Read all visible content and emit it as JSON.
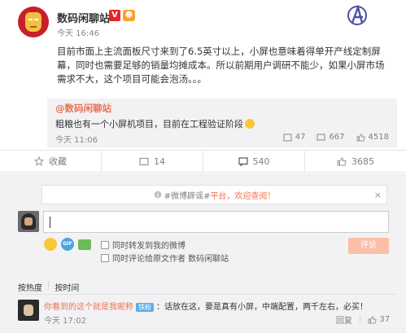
{
  "post": {
    "author": "数码闲聊站",
    "v_badge": "V",
    "vip_badge": "☻",
    "timestamp": "今天 16:46",
    "text": "目前市面上主流面板尺寸来到了6.5英寸以上，小屏也意味着得单开产线定制屏幕，同时也需要足够的销量均摊成本。所以前期用户调研不能少，如果小屏市场需求不大，这个项目可能会泡汤。。。"
  },
  "repost": {
    "author": "@数码闲聊站",
    "text": "粗粮也有一个小屏机项目，目前在工程验证阶段",
    "time": "今天 11:06",
    "forward_count": "47",
    "comment_count": "667",
    "like_count": "4518"
  },
  "actions": {
    "favorite": "收藏",
    "forward": "14",
    "comment": "540",
    "like": "3685"
  },
  "notice": {
    "prefix": "#微博辟谣#",
    "highlight": "平台，欢迎查阅！",
    "close": "×"
  },
  "compose": {
    "option_forward": "同时转发到我的微博",
    "option_comment_original": "同时评论给原文作者 数码闲聊站",
    "submit": "评论",
    "gif": "GIF"
  },
  "sort": {
    "by_hot": "按热度",
    "sep": "|",
    "by_time": "按时间"
  },
  "comment": {
    "name": "你看到的这个就是我昵称",
    "tag": "铁粉",
    "text": "：话放在这，要是真有小屏，中端配置，两千左右，必买！",
    "time": "今天 17:02",
    "reply": "回复",
    "likes": "37"
  },
  "colors": {
    "accent": "#eb7350",
    "brand_red": "#e5242b"
  }
}
